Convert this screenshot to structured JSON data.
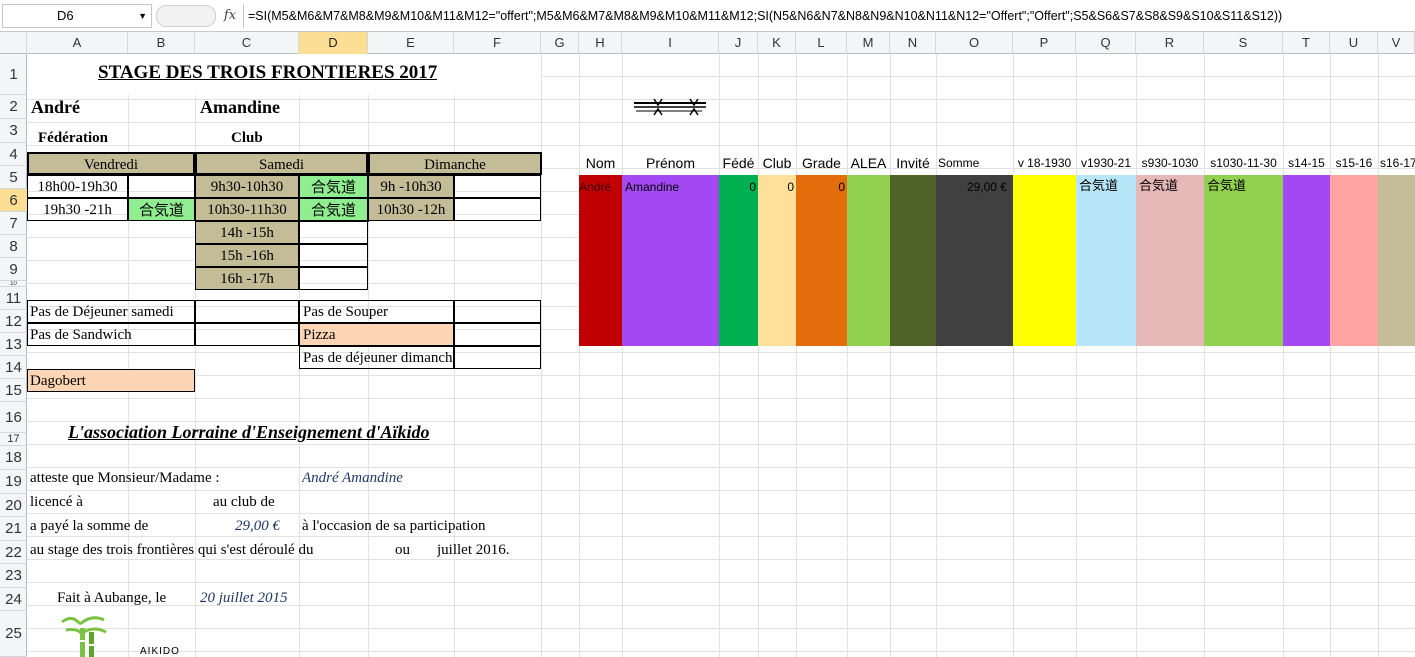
{
  "formula_bar": {
    "cell_ref": "D6",
    "fx": "fx",
    "formula": "=SI(M5&M6&M7&M8&M9&M10&M11&M12=\"offert\";M5&M6&M7&M8&M9&M10&M11&M12;SI(N5&N6&N7&N8&N9&N10&N11&N12=\"Offert\";\"Offert\";S5&S6&S7&S8&S9&S10&S11&S12))"
  },
  "columns": [
    "A",
    "B",
    "C",
    "D",
    "E",
    "F",
    "G",
    "H",
    "I",
    "J",
    "K",
    "L",
    "M",
    "N",
    "O",
    "P",
    "Q",
    "R",
    "S",
    "T",
    "U",
    "V"
  ],
  "rows": [
    "1",
    "2",
    "3",
    "4",
    "5",
    "6",
    "7",
    "8",
    "9",
    "10",
    "11",
    "12",
    "13",
    "14",
    "15",
    "16",
    "17",
    "18",
    "19",
    "20",
    "21",
    "22",
    "23",
    "24",
    "25"
  ],
  "sheet": {
    "title": "STAGE DES TROIS FRONTIERES 2017",
    "first_name": "André",
    "last_name": "Amandine",
    "federation_label": "Fédération",
    "club_label": "Club",
    "days": [
      "Vendredi",
      "Samedi",
      "Dimanche"
    ],
    "slots": {
      "fri_1": "18h00-19h30",
      "fri_2": "19h30 -21h",
      "fri_2_mark": "合気道",
      "sat_1": "9h30-10h30",
      "sat_1_mark": "合気道",
      "sat_2": "10h30-11h30",
      "sat_2_mark": "合気道",
      "sat_3": "14h -15h",
      "sat_4": "15h -16h",
      "sat_5": "16h -17h",
      "sun_1": "9h -10h30",
      "sun_2": "10h30 -12h"
    },
    "meals": {
      "no_lunch_sat": "Pas de Déjeuner samedi",
      "no_sandwich": "Pas de Sandwich",
      "no_dinner": "Pas de Souper",
      "pizza": "Pizza",
      "no_lunch_sun": "Pas de déjeuner dimanche",
      "dagobert": "Dagobert"
    },
    "assoc_title": "L'association Lorraine d'Enseignement d'Aïkido",
    "attest": "atteste que Monsieur/Madame :",
    "attest_name": "André Amandine",
    "licence": "licencé à",
    "club_de": "au club de",
    "paid": "a payé la somme de",
    "amount": "29,00 €",
    "occasion": "à l'occasion de sa participation",
    "stage_line": "au stage des trois frontières qui s'est déroulé du",
    "ou": "ou",
    "month": "juillet 2016.",
    "done_at": "Fait à Aubange, le",
    "date": "20 juillet 2015",
    "logo_text": "AÏKIDO"
  },
  "table": {
    "headers": [
      "Nom",
      "Prénom",
      "Fédé",
      "Club",
      "Grade",
      "ALEA",
      "Invité",
      "Somme",
      "v 18-1930",
      "v1930-21",
      "s930-1030",
      "s1030-11-30",
      "s14-15",
      "s15-16",
      "s16-17"
    ],
    "values": [
      "André",
      "Amandine",
      "0",
      "0",
      "0",
      "",
      "",
      "29,00 €",
      "",
      "合気道",
      "合気道",
      "合気道",
      "",
      "",
      ""
    ],
    "colors": [
      "#c00000",
      "#a349f4",
      "#00b050",
      "#ffe09a",
      "#e46c0a",
      "#92d050",
      "#4f6228",
      "#404040",
      "#ffff00",
      "#b7e6f8",
      "#e6b8b7",
      "#92d050",
      "#a349f4",
      "#ffa3a3",
      "#c4bc96"
    ]
  }
}
